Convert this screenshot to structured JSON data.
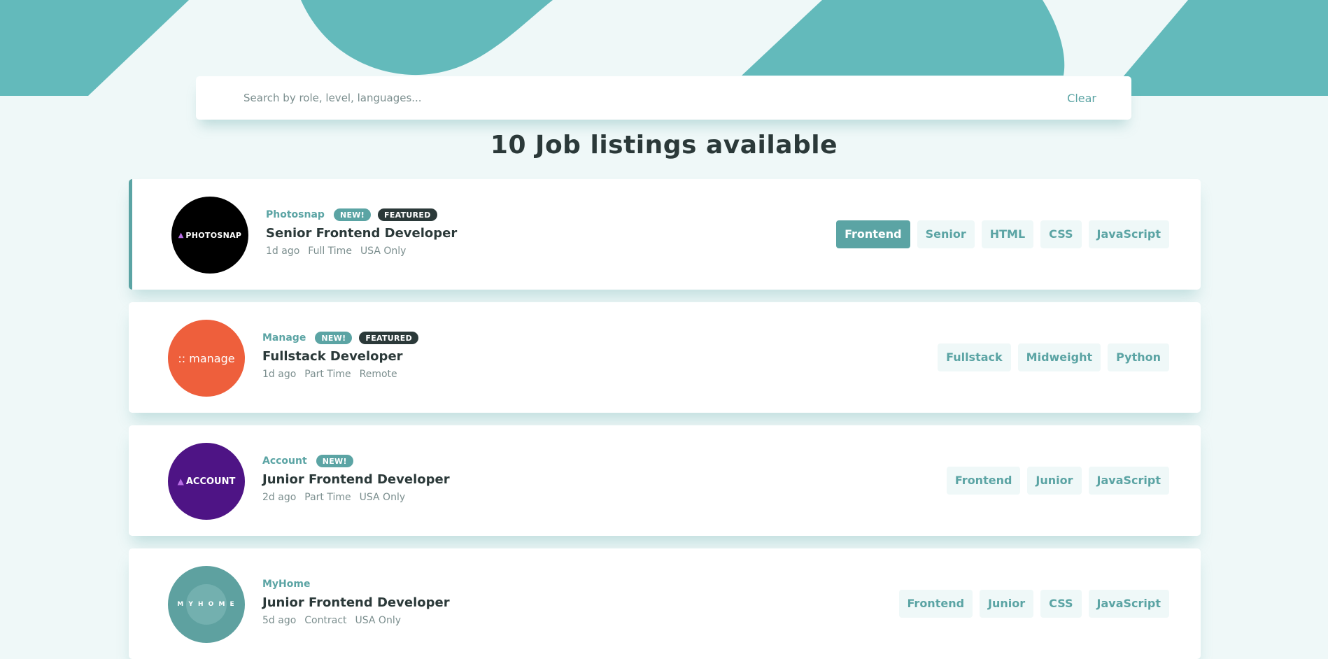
{
  "search": {
    "placeholder": "Search by role, level, languages...",
    "clear_label": "Clear"
  },
  "heading": "10 Job listings available",
  "colors": {
    "primary": "#5ba4a4",
    "dark": "#2b3939",
    "background": "#eff8f8",
    "muted": "#7b8e8e"
  },
  "jobs": [
    {
      "company": "Photosnap",
      "logo_text": "PHOTOSNAP",
      "logo_icon": "triangle-icon",
      "new_label": "NEW!",
      "featured_label": "FEATURED",
      "position": "Senior Frontend Developer",
      "posted": "1d ago",
      "contract": "Full Time",
      "location": "USA Only",
      "tags": [
        "Frontend",
        "Senior",
        "HTML",
        "CSS",
        "JavaScript"
      ],
      "active_tag": "Frontend"
    },
    {
      "company": "Manage",
      "logo_text": ":: manage",
      "new_label": "NEW!",
      "featured_label": "FEATURED",
      "position": "Fullstack Developer",
      "posted": "1d ago",
      "contract": "Part Time",
      "location": "Remote",
      "tags": [
        "Fullstack",
        "Midweight",
        "Python"
      ]
    },
    {
      "company": "Account",
      "logo_text": "ACCOUNT",
      "logo_icon": "triangle-icon",
      "new_label": "NEW!",
      "position": "Junior Frontend Developer",
      "posted": "2d ago",
      "contract": "Part Time",
      "location": "USA Only",
      "tags": [
        "Frontend",
        "Junior",
        "JavaScript"
      ]
    },
    {
      "company": "MyHome",
      "logo_text": "M Y H O M E",
      "position": "Junior Frontend Developer",
      "posted": "5d ago",
      "contract": "Contract",
      "location": "USA Only",
      "tags": [
        "Frontend",
        "Junior",
        "CSS",
        "JavaScript"
      ]
    }
  ]
}
